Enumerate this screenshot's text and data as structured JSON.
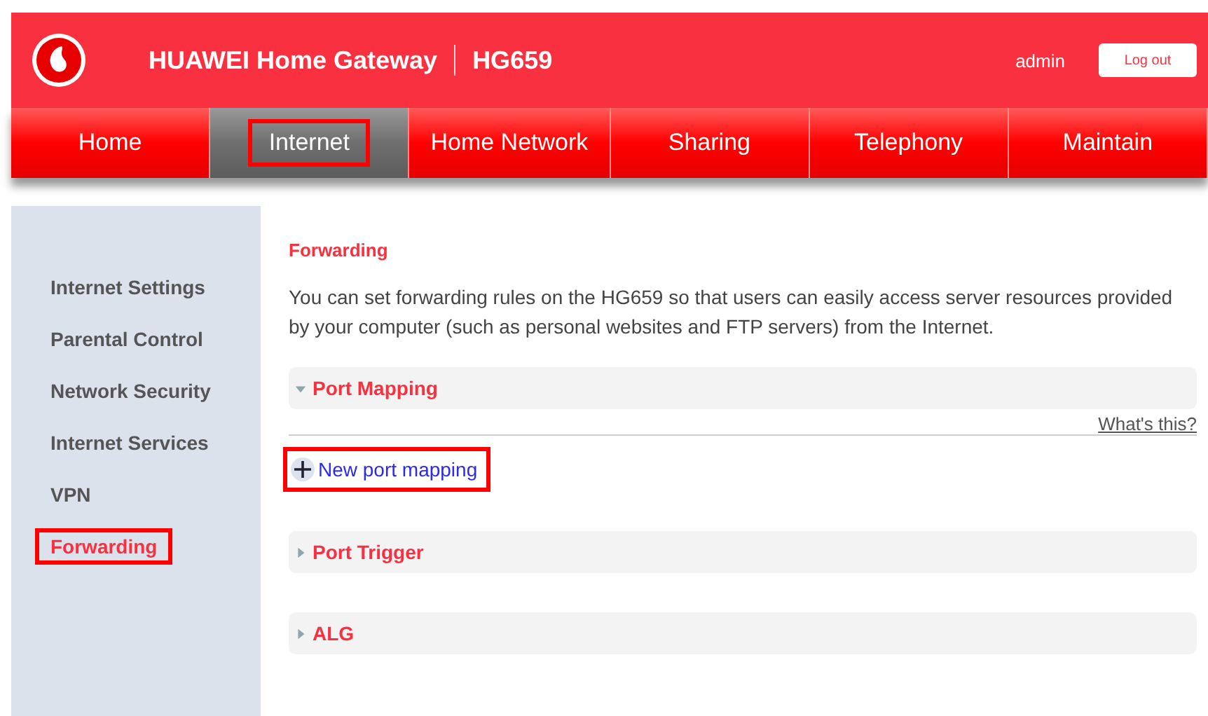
{
  "header": {
    "brand": "HUAWEI Home Gateway",
    "model": "HG659",
    "user": "admin",
    "logout": "Log out"
  },
  "tabs": [
    {
      "label": "Home",
      "selected": false,
      "highlighted": false
    },
    {
      "label": "Internet",
      "selected": true,
      "highlighted": true
    },
    {
      "label": "Home Network",
      "selected": false,
      "highlighted": false
    },
    {
      "label": "Sharing",
      "selected": false,
      "highlighted": false
    },
    {
      "label": "Telephony",
      "selected": false,
      "highlighted": false
    },
    {
      "label": "Maintain",
      "selected": false,
      "highlighted": false
    }
  ],
  "sidebar": {
    "items": [
      {
        "label": "Internet Settings",
        "selected": false,
        "highlighted": false
      },
      {
        "label": "Parental Control",
        "selected": false,
        "highlighted": false
      },
      {
        "label": "Network Security",
        "selected": false,
        "highlighted": false
      },
      {
        "label": "Internet Services",
        "selected": false,
        "highlighted": false
      },
      {
        "label": "VPN",
        "selected": false,
        "highlighted": false
      },
      {
        "label": "Forwarding",
        "selected": true,
        "highlighted": true
      }
    ]
  },
  "content": {
    "title": "Forwarding",
    "description": "You can set forwarding rules on the HG659 so that users can easily access server resources provided by your computer (such as personal websites and FTP servers) from the Internet.",
    "sections": [
      {
        "title": "Port Mapping",
        "expanded": true,
        "help_link": "What's this?",
        "action": {
          "label": "New port mapping",
          "highlighted": true
        }
      },
      {
        "title": "Port Trigger",
        "expanded": false
      },
      {
        "title": "ALG",
        "expanded": false
      }
    ]
  }
}
